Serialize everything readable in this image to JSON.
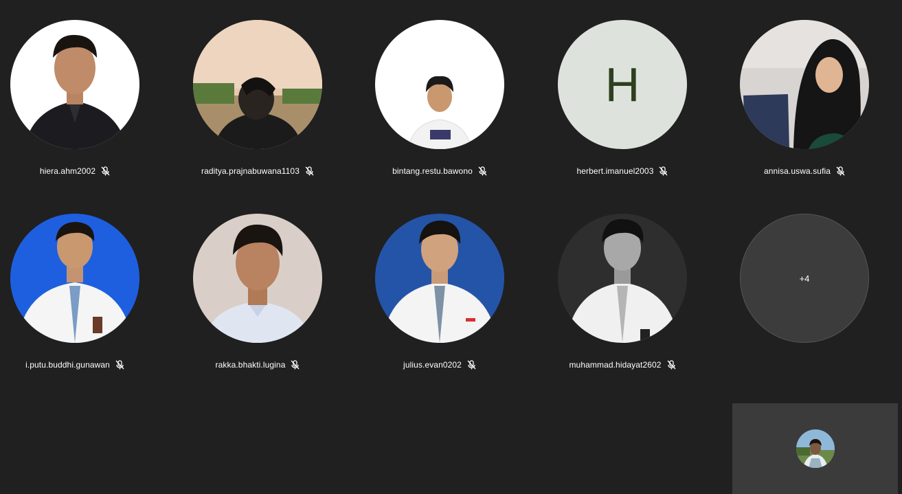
{
  "participants": [
    {
      "name": "hiera.ahm2002",
      "muted": true,
      "avatar": "photo-man-black-shirt-white-bg"
    },
    {
      "name": "raditya.prajnabuwana1103",
      "muted": true,
      "avatar": "photo-person-outdoor-field"
    },
    {
      "name": "bintang.restu.bawono",
      "muted": true,
      "avatar": "photo-young-man-white-bg"
    },
    {
      "name": "herbert.imanuel2003",
      "muted": true,
      "avatar_initial": "H"
    },
    {
      "name": "annisa.uswa.sufia",
      "muted": true,
      "avatar": "photo-woman-hijab-laptop"
    },
    {
      "name": "i.putu.buddhi.gunawan",
      "muted": true,
      "avatar": "photo-student-blue-bg"
    },
    {
      "name": "rakka.bhakti.lugina",
      "muted": true,
      "avatar": "photo-young-man-beige-bg"
    },
    {
      "name": "julius.evan0202",
      "muted": true,
      "avatar": "photo-student-dark-blue-bg"
    },
    {
      "name": "muhammad.hidayat2602",
      "muted": true,
      "avatar": "photo-student-grayscale"
    }
  ],
  "overflow": {
    "label": "+4"
  },
  "self_view": {
    "avatar": "photo-self-outdoor"
  },
  "colors": {
    "background": "#202020",
    "tile_overflow": "#3c3c3c",
    "self_view": "#3b3b3b",
    "initial_bg": "#dde3dc",
    "initial_fg": "#2e3f1f"
  }
}
